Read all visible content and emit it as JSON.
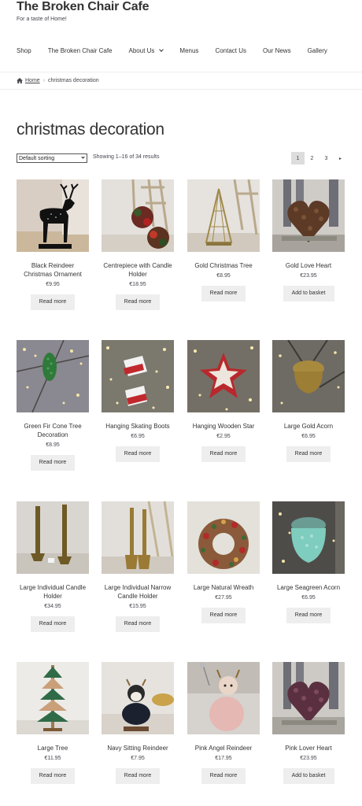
{
  "site": {
    "title": "The Broken Chair Cafe",
    "tagline": "For a taste of Home!"
  },
  "nav": [
    {
      "label": "Shop"
    },
    {
      "label": "The Broken Chair Cafe"
    },
    {
      "label": "About Us"
    },
    {
      "label": "Menus"
    },
    {
      "label": "Contact Us"
    },
    {
      "label": "Our News"
    },
    {
      "label": "Gallery"
    }
  ],
  "breadcrumb": {
    "home": "Home",
    "separator": "›",
    "current": "christmas decoration"
  },
  "page": {
    "title": "christmas decoration"
  },
  "toolbar": {
    "sort_value": "Default sorting",
    "result_count": "Showing 1–16 of 34 results",
    "pages": [
      "1",
      "2",
      "3"
    ],
    "next": "▸"
  },
  "products": [
    {
      "name": "Black Reindeer Christmas Ornament",
      "price": "€9.95",
      "button": "Read more"
    },
    {
      "name": "Centrepiece with Candle Holder",
      "price": "€18.95",
      "button": "Read more"
    },
    {
      "name": "Gold Christmas Tree",
      "price": "€8.95",
      "button": "Read more"
    },
    {
      "name": "Gold Love Heart",
      "price": "€23.95",
      "button": "Add to basket"
    },
    {
      "name": "Green Fir Cone Tree Decoration",
      "price": "€8.95",
      "button": "Read more"
    },
    {
      "name": "Hanging Skating Boots",
      "price": "€6.95",
      "button": "Read more"
    },
    {
      "name": "Hanging Wooden Star",
      "price": "€2.95",
      "button": "Read more"
    },
    {
      "name": "Large Gold Acorn",
      "price": "€6.95",
      "button": "Read more"
    },
    {
      "name": "Large Individual Candle Holder",
      "price": "€34.95",
      "button": "Read more"
    },
    {
      "name": "Large Individual Narrow Candle Holder",
      "price": "€15.95",
      "button": "Read more"
    },
    {
      "name": "Large Natural Wreath",
      "price": "€27.95",
      "button": "Read more"
    },
    {
      "name": "Large Seagreen Acorn",
      "price": "€6.95",
      "button": "Read more"
    },
    {
      "name": "Large Tree",
      "price": "€11.95",
      "button": "Read more"
    },
    {
      "name": "Navy Sitting Reindeer",
      "price": "€7.95",
      "button": "Read more"
    },
    {
      "name": "Pink Angel Reindeer",
      "price": "€17.95",
      "button": "Read more"
    },
    {
      "name": "Pink Lover Heart",
      "price": "€23.95",
      "button": "Add to basket"
    }
  ]
}
